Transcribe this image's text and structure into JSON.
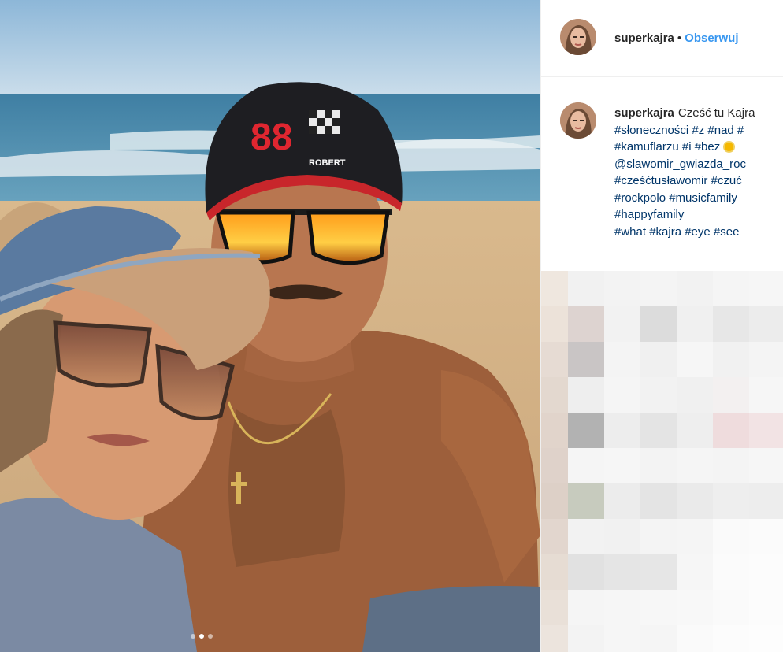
{
  "header": {
    "username": "superkajra",
    "separator": "•",
    "follow_label": "Obserwuj",
    "avatar_icon": "profile-avatar"
  },
  "caption": {
    "username": "superkajra",
    "lines": [
      "Cześć tu Kajra",
      "#słoneczności #z #nad #",
      "#kamuflarzu #i #bez ",
      "@slawomir_gwiazda_roc",
      "#cześćtusławomir #czuć",
      "#rockpolo #musicfamily",
      "#happyfamily",
      "#what #kajra #eye #see"
    ],
    "emoji_icon": "sun-emoji-icon"
  },
  "photo": {
    "cap_number": "88",
    "cap_text": "ROBERT",
    "carousel_count": 3,
    "carousel_active": 2
  },
  "pixel_colors": [
    "#efe7df",
    "#f1f1f1",
    "#f3f3f3",
    "#f4f4f4",
    "#f2f2f2",
    "#f5f5f5",
    "#f6f6f6",
    "#ece2d9",
    "#ddd3d0",
    "#f2f2f2",
    "#dcdcdc",
    "#f0f0f0",
    "#e7e7e7",
    "#ececec",
    "#e6dbd3",
    "#c9c5c5",
    "#f4f4f4",
    "#f0f0f0",
    "#f6f6f6",
    "#f1f1f1",
    "#f4f4f4",
    "#e3d8cf",
    "#eeeeee",
    "#f5f5f5",
    "#f2f2f2",
    "#f0f0f0",
    "#f3f0f0",
    "#f6f6f6",
    "#e1d4cb",
    "#b2b2b2",
    "#ededed",
    "#e4e4e4",
    "#eeeeee",
    "#efdcdd",
    "#f2e3e4",
    "#dfd2ca",
    "#f5f5f5",
    "#f6f6f6",
    "#f3f3f3",
    "#f5f5f5",
    "#f4f4f4",
    "#f6f6f6",
    "#ddd0c7",
    "#c7cbbe",
    "#ececec",
    "#e4e4e4",
    "#eaeaea",
    "#eeeeee",
    "#ededed",
    "#e2d6ce",
    "#f2f2f2",
    "#f1f1f1",
    "#f4f4f4",
    "#f5f5f5",
    "#fafafa",
    "#fbfbfb",
    "#e6dcd3",
    "#e1e1e1",
    "#e5e5e5",
    "#e6e6e6",
    "#f6f6f6",
    "#fbfbfb",
    "#fcfcfc",
    "#e9e0d8",
    "#f5f5f5",
    "#f6f6f6",
    "#f7f7f7",
    "#f8f8f8",
    "#fafafa",
    "#fcfcfc",
    "#ece4dd",
    "#f3f3f3",
    "#f6f6f6",
    "#f5f5f5",
    "#fafafa",
    "#fcfcfc",
    "#fdfdfd"
  ],
  "colors": {
    "follow_blue": "#3897f0",
    "hashtag_blue": "#003569",
    "text": "#262626"
  }
}
